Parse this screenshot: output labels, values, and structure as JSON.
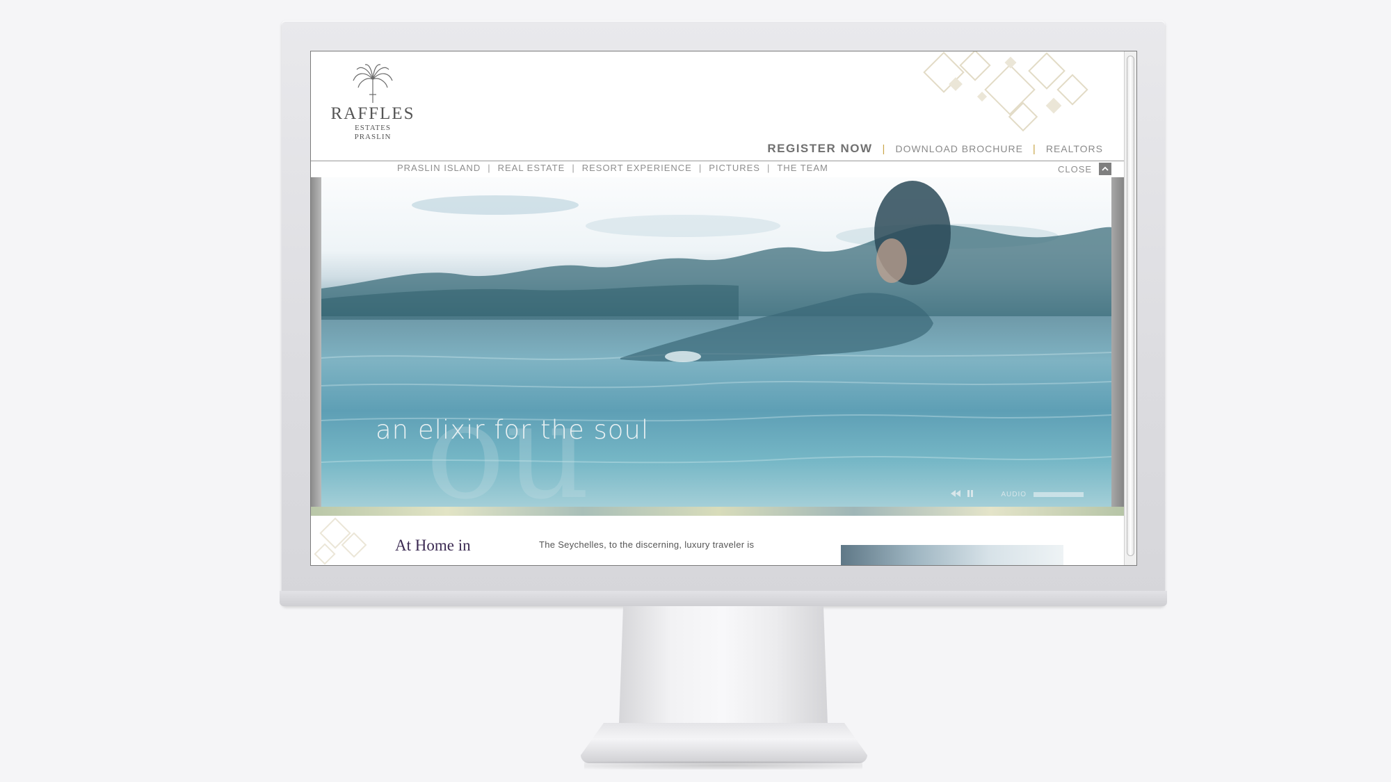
{
  "logo": {
    "name": "RAFFLES",
    "line1": "ESTATES",
    "line2": "PRASLIN"
  },
  "top_links": {
    "register": "REGISTER NOW",
    "brochure": "DOWNLOAD BROCHURE",
    "realtors": "REALTORS",
    "separator": "|"
  },
  "nav": {
    "items": [
      {
        "label": "PRASLIN ISLAND"
      },
      {
        "label": "REAL ESTATE"
      },
      {
        "label": "RESORT EXPERIENCE"
      },
      {
        "label": "PICTURES"
      },
      {
        "label": "THE TEAM"
      }
    ],
    "separator": "|",
    "close": "CLOSE"
  },
  "hero": {
    "tagline": "an elixir for the soul",
    "audio_label": "AUDIO"
  },
  "content": {
    "title": "At Home in",
    "intro": "The Seychelles, to the discerning, luxury traveler is"
  },
  "icons": {
    "close": "chevron-up-icon",
    "rewind": "rewind-icon",
    "pause": "pause-icon"
  },
  "colors": {
    "accent_gold": "#c9a64a",
    "title_purple": "#3b2a52",
    "nav_gray": "#8d8d8d"
  }
}
